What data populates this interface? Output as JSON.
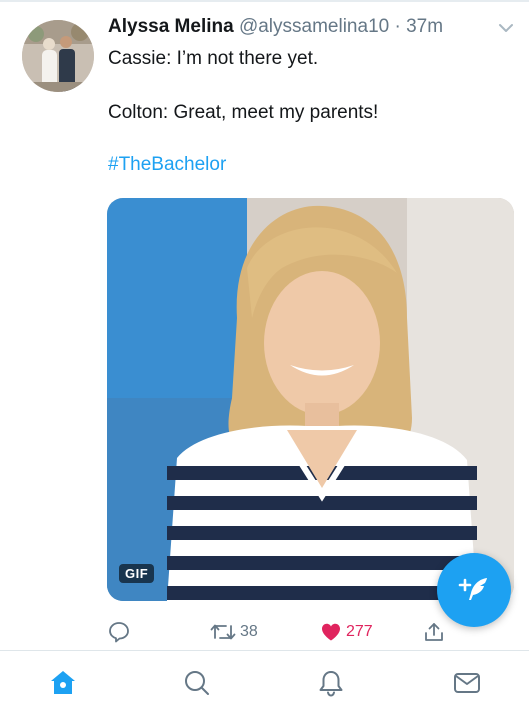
{
  "tweet": {
    "author_name": "Alyssa Melina",
    "handle": "@alyssamelina10",
    "separator": "·",
    "time": "37m",
    "lines": [
      "Cassie: I’m not there yet.",
      "Colton: Great, meet my parents!"
    ],
    "hashtag": "#TheBachelor",
    "media_badge": "GIF"
  },
  "actions": {
    "reply_icon": "reply-icon",
    "retweet_icon": "retweet-icon",
    "retweet_count": "38",
    "like_icon": "heart-icon",
    "like_count": "277",
    "share_icon": "share-icon"
  },
  "compose_icon": "compose-tweet-icon",
  "bottom_nav": {
    "items": [
      "home-icon",
      "search-icon",
      "notifications-icon",
      "messages-icon"
    ],
    "active": "home-icon"
  },
  "colors": {
    "accent": "#1da1f2",
    "like": "#e0245e",
    "muted": "#657786",
    "text": "#14171a"
  }
}
